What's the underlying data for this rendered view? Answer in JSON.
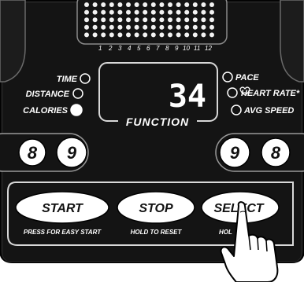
{
  "matrix": {
    "columns": [
      "1",
      "2",
      "3",
      "4",
      "5",
      "6",
      "7",
      "8",
      "9",
      "10",
      "11",
      "12"
    ]
  },
  "display": {
    "value": "34",
    "function_label": "FUNCTION"
  },
  "left_indicators": [
    "TIME",
    "DISTANCE",
    "CALORIES"
  ],
  "right_indicators": [
    "PACE",
    "HEART RATE*",
    "AVG SPEED"
  ],
  "left_keys": [
    "8",
    "9"
  ],
  "right_keys": [
    "9",
    "8"
  ],
  "buttons": {
    "start": {
      "label": "START",
      "hint": "PRESS FOR EASY START"
    },
    "stop": {
      "label": "STOP",
      "hint": "HOLD TO RESET"
    },
    "select": {
      "label": "SELECT",
      "hint": "HOL"
    }
  },
  "colors": {
    "panel": "#141414",
    "white": "#ffffff",
    "dot": "#f2f2f2"
  }
}
